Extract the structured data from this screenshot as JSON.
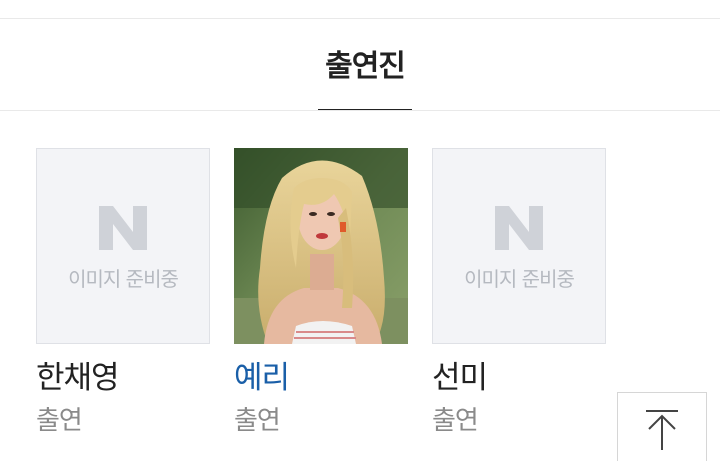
{
  "tabs": [
    {
      "label": "출연진",
      "active": true
    }
  ],
  "cast": [
    {
      "name": "한채영",
      "role": "출연",
      "photo": "placeholder",
      "placeholder_text": "이미지 준비중",
      "name_color": "#222222"
    },
    {
      "name": "예리",
      "role": "출연",
      "photo": "portrait-photo",
      "name_color": "#1a5fa8"
    },
    {
      "name": "선미",
      "role": "출연",
      "photo": "placeholder",
      "placeholder_text": "이미지 준비중",
      "name_color": "#222222"
    }
  ],
  "icons": {
    "placeholder_logo": "naver-n-logo",
    "scroll_top": "arrow-up-icon"
  },
  "colors": {
    "active_tab_underline": "#222222",
    "highlight_name": "#1a5fa8",
    "placeholder_bg": "#f3f4f7",
    "placeholder_text": "#b5b9c0"
  }
}
